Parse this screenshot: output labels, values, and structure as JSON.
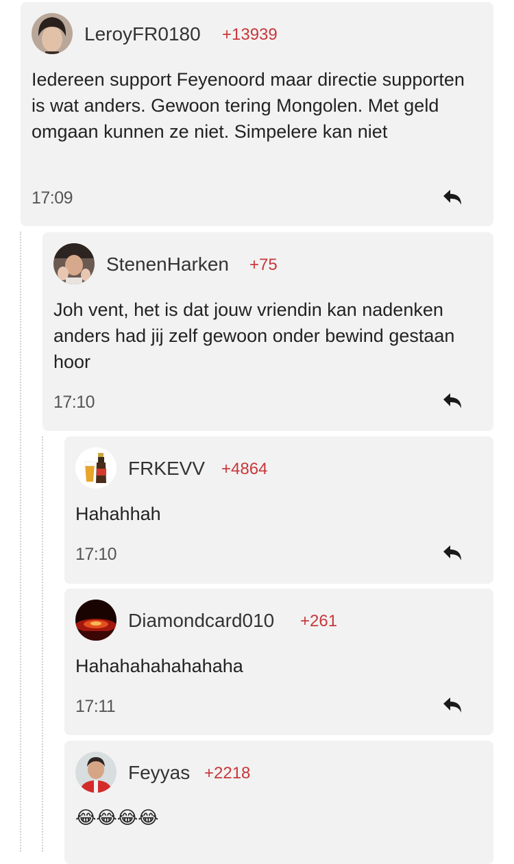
{
  "comments": [
    {
      "username": "LeroyFR0180",
      "score": "+13939",
      "text": "Iedereen support Feyenoord maar directie supporten is wat anders. Gewoon tering Mongolen. Met geld omgaan kunnen ze niet. Simpelere kan niet",
      "time": "17:09"
    },
    {
      "username": "StenenHarken",
      "score": "+75",
      "text": "Joh vent, het is dat jouw vriendin kan nadenken anders had jij zelf gewoon onder bewind gestaan hoor",
      "time": "17:10"
    },
    {
      "username": "FRKEVV",
      "score": "+4864",
      "text": "Hahahhah",
      "time": "17:10"
    },
    {
      "username": "Diamondcard010",
      "score": "+261",
      "text": "Hahahahahahahaha",
      "time": "17:11"
    },
    {
      "username": "Feyyas",
      "score": "+2218",
      "text": "😂😂😂😂",
      "time": ""
    }
  ],
  "colors": {
    "card_bg": "#f2f2f2",
    "score": "#c8373b",
    "username": "#333333"
  },
  "icons": {
    "reply": "reply-arrow-icon"
  }
}
